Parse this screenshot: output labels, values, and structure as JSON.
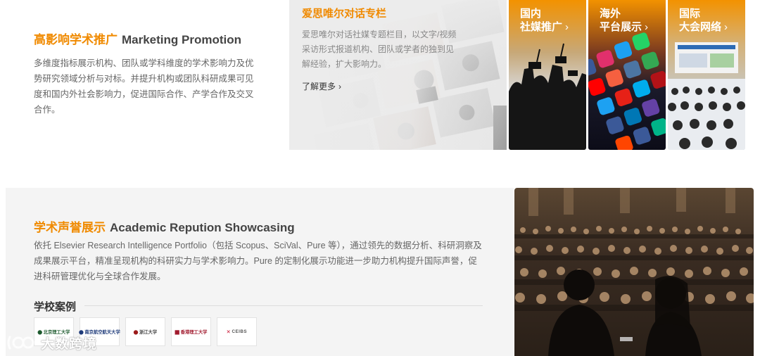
{
  "marketing": {
    "title_zh": "高影响学术推广",
    "title_en": "Marketing Promotion",
    "description": "多维度指标展示机构、团队或学科维度的学术影响力及优势研究领域分析与对标。并提升机构或团队科研成果可见度和国内外社会影响力，促进国际合作、产学合作及交叉合作。"
  },
  "dialog_column": {
    "title": "爱思唯尔对话专栏",
    "description": "爱思唯尔对话社媒专题栏目，以文字/视频采访形式报道机构、团队或学者的独到见解经验，扩大影响力。",
    "more_label": "了解更多"
  },
  "cards": [
    {
      "line1": "国内",
      "line2": "社媒推广"
    },
    {
      "line1": "海外",
      "line2": "平台展示"
    },
    {
      "line1": "国际",
      "line2": "大会网络"
    }
  ],
  "reputation": {
    "title_zh": "学术声誉展示",
    "title_en": "Academic Repution Showcasing",
    "description": "依托 Elsevier Research Intelligence Portfolio（包括 Scopus、SciVal、Pure 等），通过领先的数据分析、科研洞察及成果展示平台，精准呈现机构的科研实力与学术影响力。Pure 的定制化展示功能进一步助力机构提升国际声誉，促进科研管理优化与全球合作发展。"
  },
  "cases": {
    "title": "学校案例",
    "logos": [
      {
        "name": "北京理工大学"
      },
      {
        "name": "南京航空航天大学"
      },
      {
        "name": "浙江大学"
      },
      {
        "name": "香港理工大学"
      },
      {
        "name": "CEIBS"
      }
    ]
  },
  "watermark": {
    "text": "大数跨境"
  },
  "colors": {
    "accent": "#f08a00",
    "panel_bg": "#f4f4f4",
    "text": "#666666"
  }
}
